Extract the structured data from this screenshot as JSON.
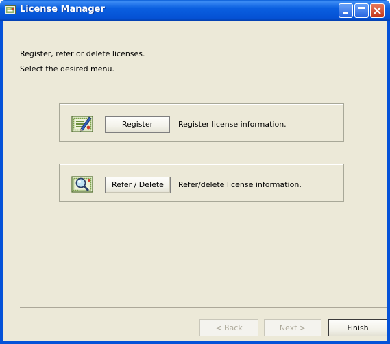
{
  "window": {
    "title": "License Manager",
    "icon": "license-manager-app-icon"
  },
  "intro": {
    "line1": "Register, refer or delete licenses.",
    "line2": "Select the desired menu."
  },
  "options": [
    {
      "icon": "certificate-pen-icon",
      "button_label": "Register",
      "description": "Register license information."
    },
    {
      "icon": "certificate-magnifier-icon",
      "button_label": "Refer / Delete",
      "description": "Refer/delete license information."
    }
  ],
  "navigation": {
    "back_label": "< Back",
    "next_label": "Next >",
    "finish_label": "Finish",
    "back_enabled": false,
    "next_enabled": false,
    "finish_enabled": true
  },
  "colors": {
    "titlebar": "#0a5fd8",
    "client_background": "#ece9d8",
    "close_button": "#c4361a"
  }
}
